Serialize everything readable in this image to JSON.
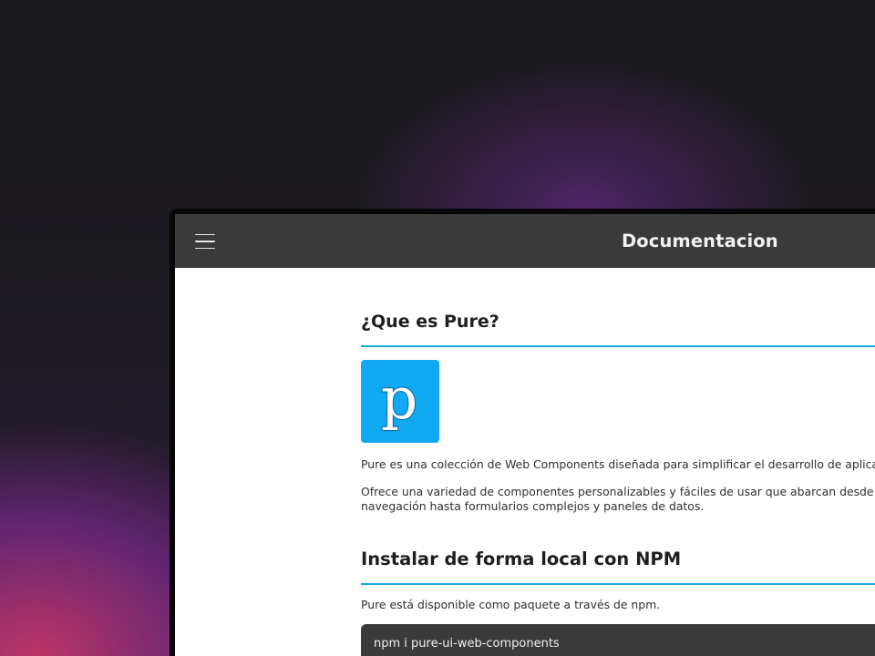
{
  "app": {
    "title": "Documentacion"
  },
  "header": {
    "menu_icon": "hamburger-menu-icon"
  },
  "sections": {
    "what": {
      "heading": "¿Que es Pure?",
      "logo_letter": "p",
      "paragraph_1": "Pure es una colección de Web Components diseñada para simplificar el desarrollo de aplicac",
      "paragraph_2_line_1": "Ofrece una variedad de componentes personalizables y fáciles de usar que abarcan desde b",
      "paragraph_2_line_2": "navegación hasta formularios complejos y paneles de datos."
    },
    "install": {
      "heading": "Instalar de forma local con NPM",
      "paragraph": "Pure está disponible como paquete a través de npm.",
      "command": "npm i pure-ui-web-components"
    }
  },
  "colors": {
    "topbar": "#3a3a3a",
    "accent": "#1aa7e0",
    "logo_background": "#10a9f2",
    "code_background": "#3a3a3a"
  }
}
